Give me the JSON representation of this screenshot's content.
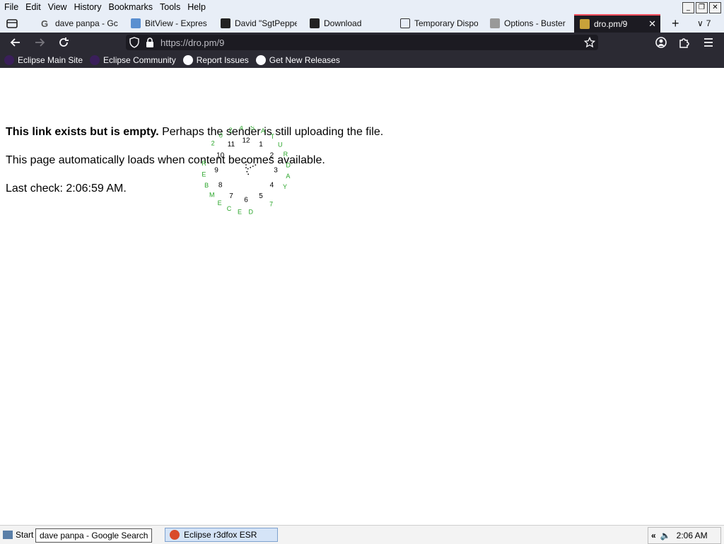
{
  "menu": [
    "File",
    "Edit",
    "View",
    "History",
    "Bookmarks",
    "Tools",
    "Help"
  ],
  "window_controls": [
    "minimize",
    "restore",
    "close"
  ],
  "tabs": [
    {
      "label": "dave panpa - Gc",
      "icon": "google-icon"
    },
    {
      "label": "BitView - Expres:",
      "icon": "bitview-icon"
    },
    {
      "label": "David \"SgtPeppe",
      "icon": "youtube-icon"
    },
    {
      "label": "Download",
      "icon": "download-icon"
    },
    {
      "label": "Temporary Dispo",
      "icon": "mail-icon"
    },
    {
      "label": "Options - Buster",
      "icon": "puzzle-icon"
    },
    {
      "label": "dro.pm/9",
      "icon": "folder-icon",
      "active": true
    }
  ],
  "tab_count": "7",
  "url": "https://dro.pm/9",
  "bookmarks": [
    "Eclipse Main Site",
    "Eclipse Community",
    "Report Issues",
    "Get New Releases"
  ],
  "page": {
    "line1_bold": "This link exists but is empty.",
    "line1_rest": " Perhaps the sender is still uploading the file.",
    "line2": "This page automatically loads when content becomes available.",
    "line3": "Last check: 2:06:59 AM."
  },
  "clock": {
    "numbers": [
      "12",
      "1",
      "2",
      "3",
      "4",
      "5",
      "6",
      "7",
      "8",
      "9",
      "10",
      "11"
    ],
    "date_text": "SATURDAY 7 DECEMBER 2024",
    "date_color": "#2aa52a"
  },
  "taskbar": {
    "start": "Start",
    "tooltip": "dave panpa - Google Search",
    "app": "Eclipse r3dfox ESR",
    "time": "2:06 AM"
  }
}
